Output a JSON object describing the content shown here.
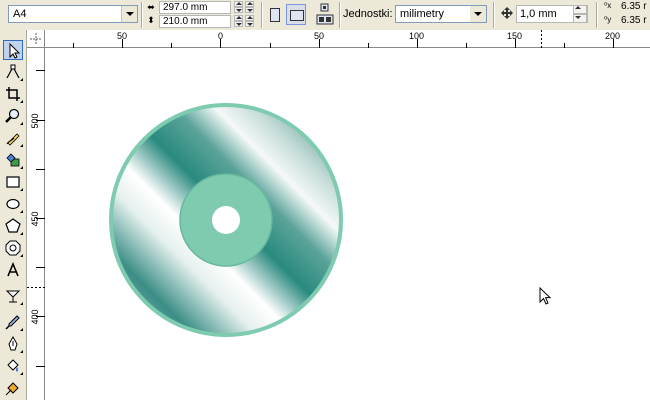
{
  "property_bar": {
    "paper_size": "A4",
    "width_value": "297.0 mm",
    "height_value": "210.0 mm",
    "units_label": "Jednostki:",
    "units_value": "milimetry",
    "nudge_value": "1,0 mm",
    "dup_x_value": "6.35 r",
    "dup_y_value": "6.35 r"
  },
  "horizontal_ruler": {
    "labels": [
      "50",
      "0",
      "50",
      "100",
      "150",
      "200"
    ]
  },
  "vertical_ruler": {
    "labels": [
      "500",
      "450",
      "400"
    ]
  },
  "toolbox": {
    "tools": [
      "pick-tool",
      "shape-tool",
      "crop-tool",
      "zoom-tool",
      "freehand-tool",
      "smart-fill-tool",
      "rectangle-tool",
      "ellipse-tool",
      "polygon-tool",
      "basic-shapes-tool",
      "text-tool",
      "interactive-blend-tool",
      "eyedropper-tool",
      "outline-tool",
      "fill-tool",
      "interactive-fill-tool"
    ]
  },
  "colors": {
    "cd_outer_rim": "#7fcbb0",
    "cd_hub": "#7fcbb0",
    "cd_dark": "#2a8a7e",
    "cd_light": "#ffffff",
    "ui_face": "#ece9d8",
    "active_tool": "#c1d2ee"
  }
}
